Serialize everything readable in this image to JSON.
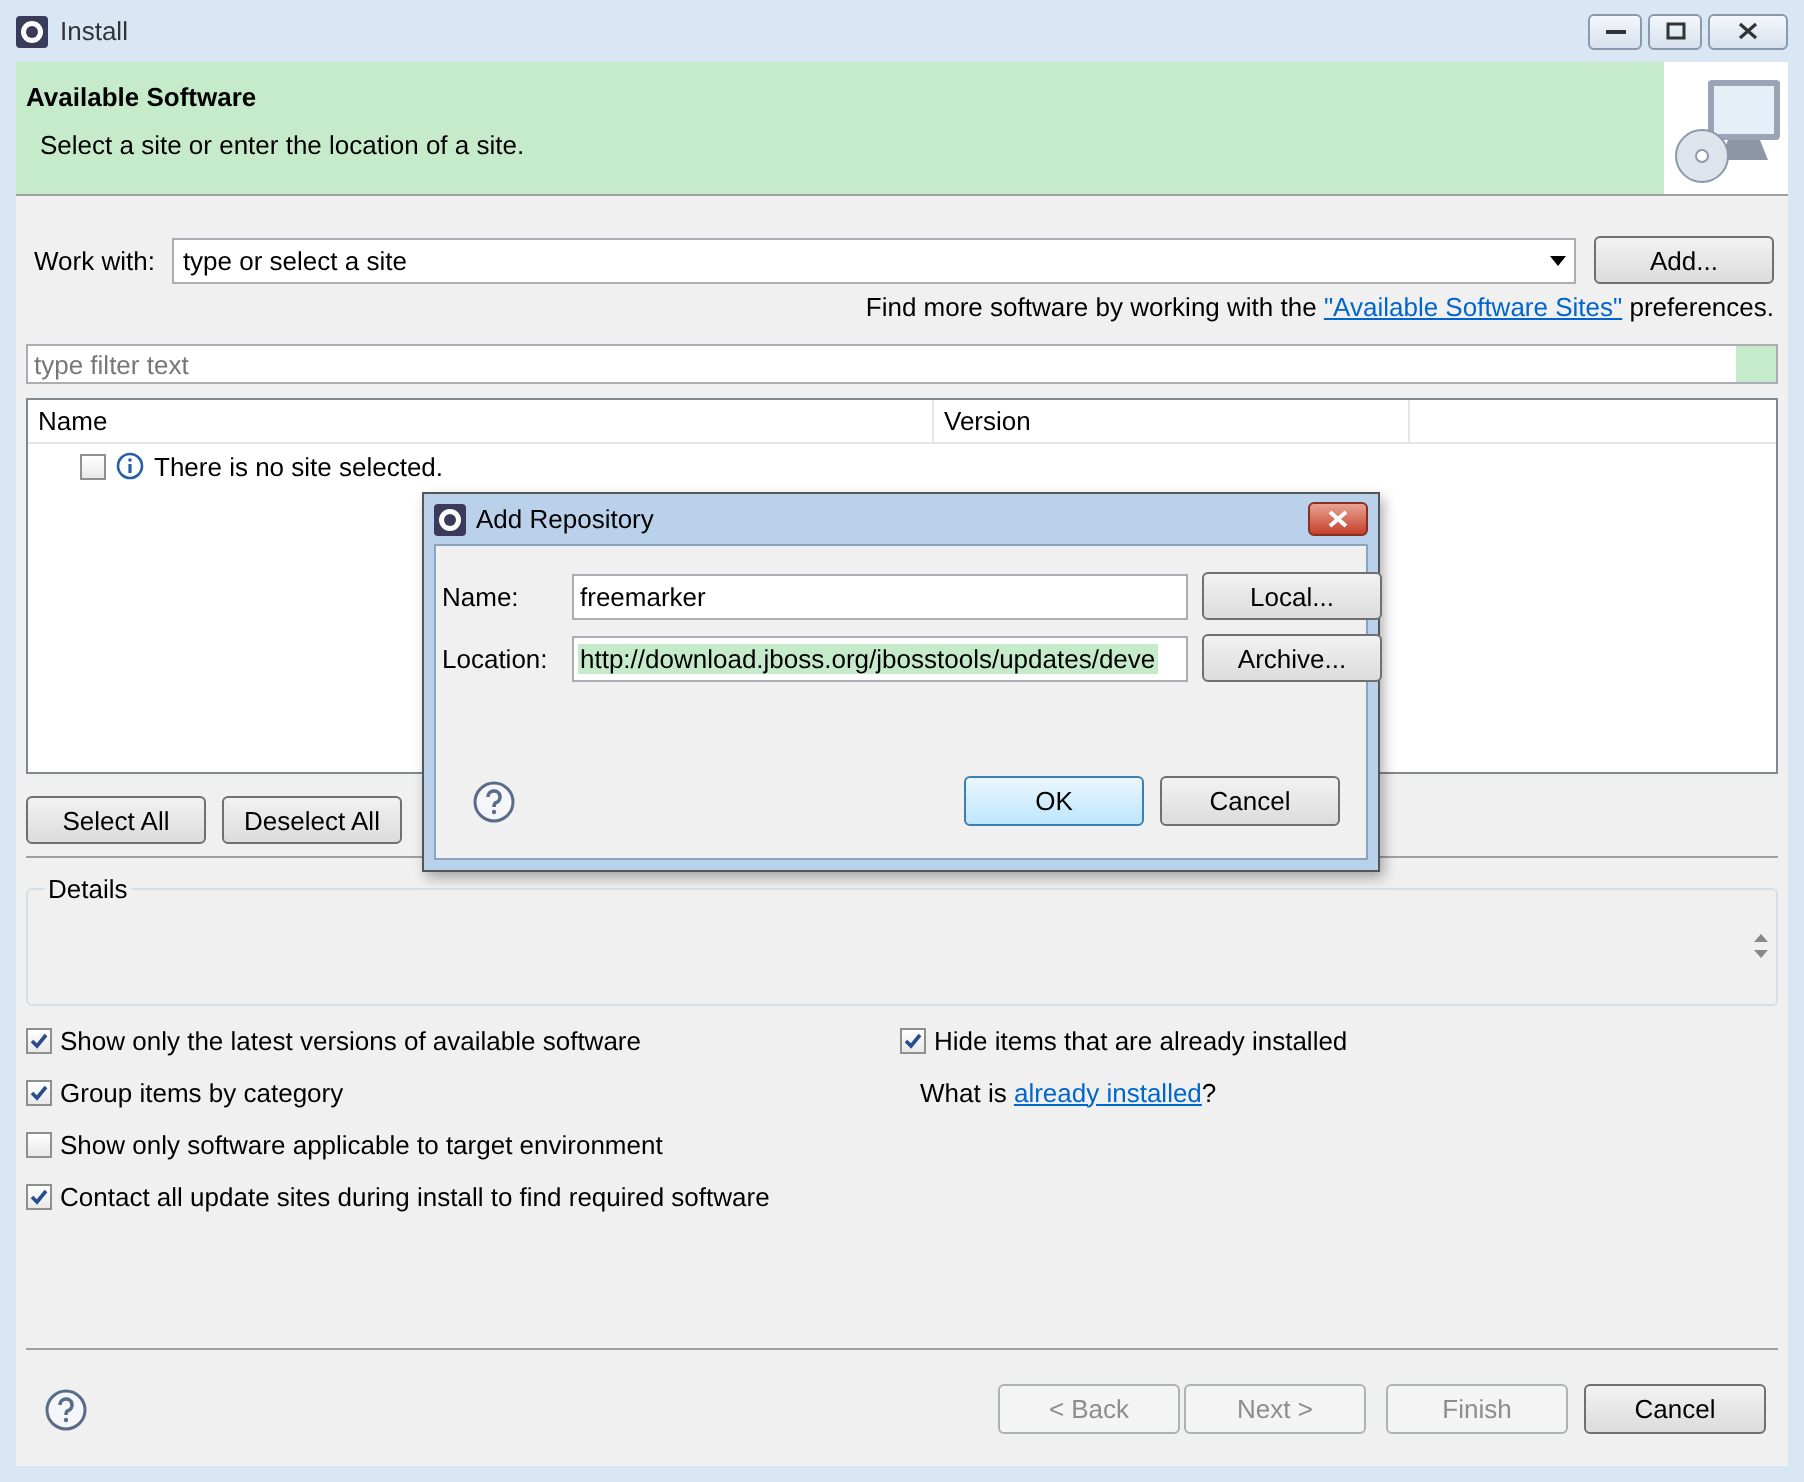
{
  "window": {
    "title": "Install"
  },
  "banner": {
    "title": "Available Software",
    "description": "Select a site or enter the location of a site."
  },
  "work_with": {
    "label": "Work with:",
    "value": "type or select a site",
    "button": "Add..."
  },
  "hint": {
    "before": "Find more software by working with the ",
    "link": "\"Available Software Sites\"",
    "after": " preferences."
  },
  "filter": {
    "placeholder": "type filter text"
  },
  "table": {
    "columns": [
      "Name",
      "Version"
    ],
    "rows": [
      {
        "checked": false,
        "text": "There is no site selected."
      }
    ]
  },
  "selection_buttons": [
    "Select All",
    "Deselect All"
  ],
  "details": {
    "label": "Details"
  },
  "options": [
    {
      "label": "Show only the latest versions of available software",
      "checked": true
    },
    {
      "label": "Group items by category",
      "checked": true
    },
    {
      "label": "Show only software applicable to target environment",
      "checked": false
    },
    {
      "label": "Contact all update sites during install to find required software",
      "checked": true
    }
  ],
  "right_options": [
    {
      "label": "Hide items that are already installed",
      "checked": true
    }
  ],
  "installed_hint": {
    "before": "What is ",
    "link": "already installed",
    "after": "?"
  },
  "footer_buttons": [
    {
      "label": "< Back",
      "disabled": true
    },
    {
      "label": "Next >",
      "disabled": true
    },
    {
      "label": "Finish",
      "disabled": true
    },
    {
      "label": "Cancel",
      "disabled": false
    }
  ],
  "dialog": {
    "title": "Add Repository",
    "fields": [
      {
        "label": "Name:",
        "value": "freemarker",
        "button": "Local...",
        "highlighted": false
      },
      {
        "label": "Location:",
        "value": "http://download.jboss.org/jbosstools/updates/deve",
        "button": "Archive...",
        "highlighted": true
      }
    ],
    "buttons": [
      {
        "label": "OK",
        "default": true
      },
      {
        "label": "Cancel",
        "default": false
      }
    ]
  }
}
